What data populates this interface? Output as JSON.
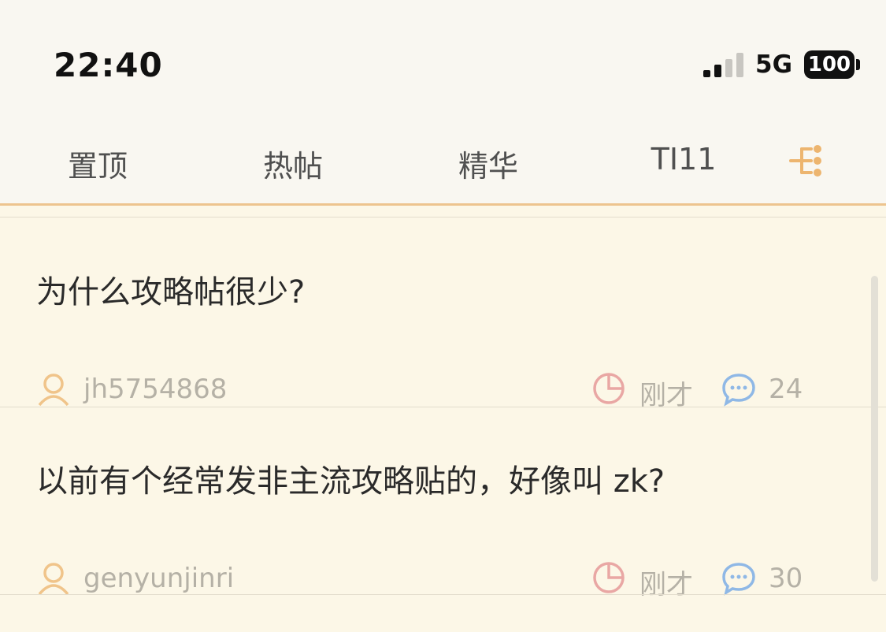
{
  "status_bar": {
    "time": "22:40",
    "network": "5G",
    "battery": "100",
    "signal_level": 2,
    "signal_max": 4
  },
  "tabs": [
    {
      "label": "置顶"
    },
    {
      "label": "热帖"
    },
    {
      "label": "精华"
    },
    {
      "label": "TI11"
    }
  ],
  "tab_extra_icon": "tree-structure-icon",
  "posts": [
    {
      "title": "为什么攻略帖很少?",
      "author": "jh5754868",
      "time": "刚才",
      "comments": "24"
    },
    {
      "title": "以前有个经常发非主流攻略贴的，好像叫 zk?",
      "author": "genyunjinri",
      "time": "刚才",
      "comments": "30"
    }
  ],
  "colors": {
    "accent": "#edc48e",
    "author_icon": "#f0c48a",
    "time_icon": "#e9a7a4",
    "comment_icon": "#8fb8e6",
    "meta_text": "#b5b1a6"
  }
}
